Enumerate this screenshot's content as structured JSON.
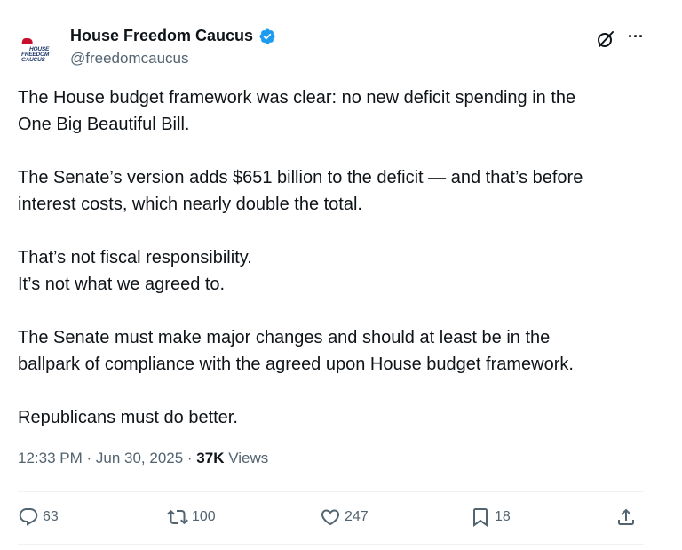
{
  "account": {
    "display_name": "House Freedom Caucus",
    "handle": "@freedomcaucus",
    "avatar_lines": [
      "HOUSE",
      "FREEDOM",
      "CAUCUS"
    ],
    "verified_color": "#1d9bf0"
  },
  "tweet": {
    "paragraphs": [
      [
        "The House budget framework was clear: no new deficit spending in the",
        "One Big Beautiful Bill."
      ],
      [
        "The Senate’s version adds $651 billion to the deficit — and that’s before",
        "interest costs, which nearly double the total."
      ],
      [
        "That’s not fiscal responsibility.",
        "It’s not what we agreed to."
      ],
      [
        "The Senate must make major changes and should at least be in the",
        "ballpark of compliance with the agreed upon House budget framework."
      ],
      [
        "Republicans must do better."
      ]
    ],
    "timestamp": "12:33 PM · Jun 30, 2025",
    "separator": " · ",
    "views_count": "37K",
    "views_label": "Views"
  },
  "actions": {
    "reply_count": "63",
    "retweet_count": "100",
    "like_count": "247",
    "bookmark_count": "18"
  },
  "icons": {
    "grok": "grok-icon",
    "more": "more-icon",
    "reply": "reply-icon",
    "retweet": "retweet-icon",
    "like": "heart-icon",
    "bookmark": "bookmark-icon",
    "share": "share-icon"
  },
  "colors": {
    "text": "#0f1419",
    "secondary": "#536471",
    "divider": "#eff3f4",
    "brand_red": "#c8102e",
    "brand_navy": "#1f3a68"
  }
}
